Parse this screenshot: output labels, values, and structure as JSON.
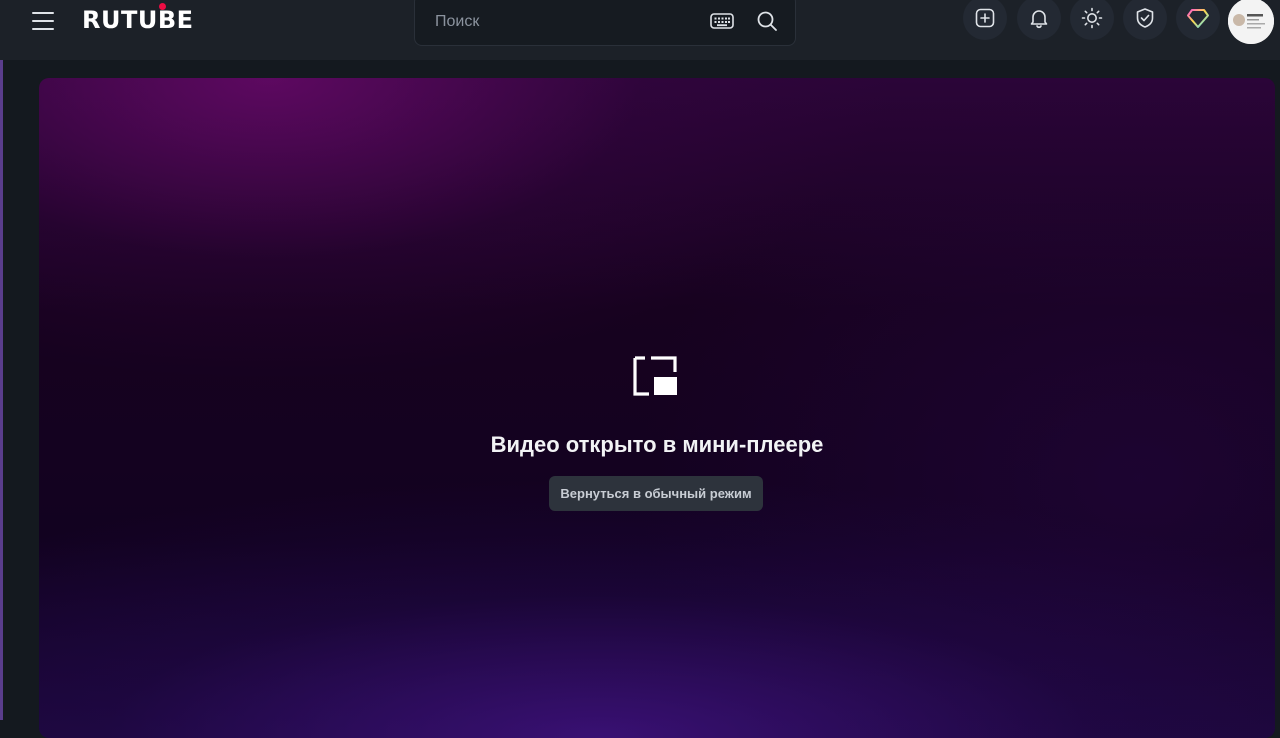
{
  "header": {
    "logo_text": "RUTUBE",
    "search": {
      "placeholder": "Поиск"
    },
    "icons": [
      "menu-icon",
      "keyboard-icon",
      "search-icon",
      "add-video-icon",
      "bell-icon",
      "sun-icon",
      "shield-check-icon",
      "diamond-icon",
      "avatar"
    ]
  },
  "player": {
    "icon": "picture-in-picture-icon",
    "title": "Видео открыто в мини-плеере",
    "return_button": "Вернуться в обычный режим"
  },
  "colors": {
    "logo_dot": "#ec0c43",
    "header_bg": "#1c2128",
    "page_bg": "#14191f"
  }
}
